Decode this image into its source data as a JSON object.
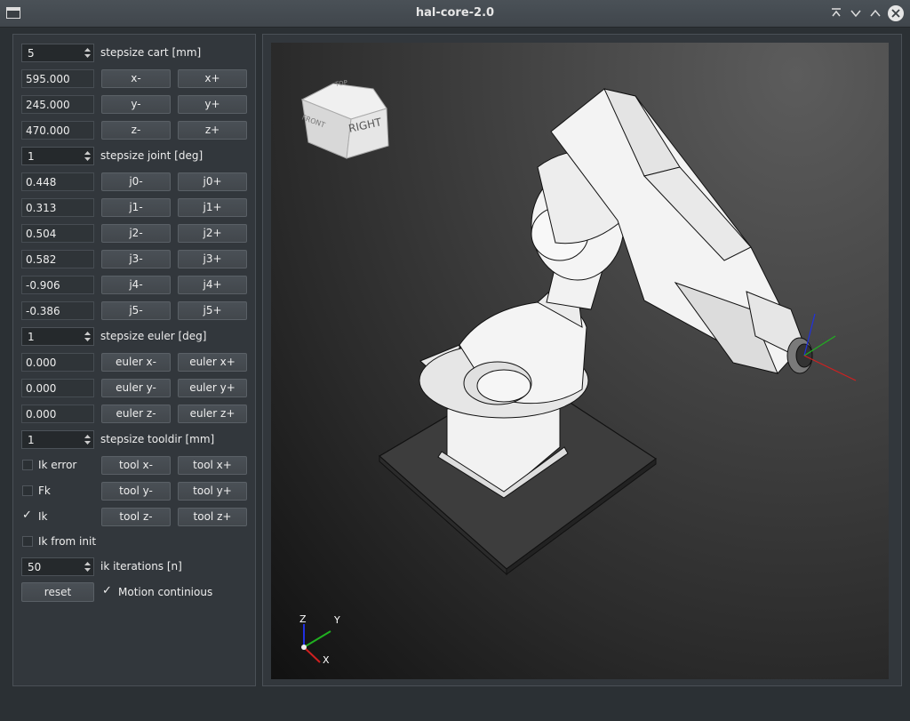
{
  "window": {
    "title": "hal-core-2.0"
  },
  "cart": {
    "stepsize": "5",
    "stepsize_label": "stepsize cart [mm]",
    "rows": [
      {
        "value": "595.000",
        "minus": "x-",
        "plus": "x+"
      },
      {
        "value": "245.000",
        "minus": "y-",
        "plus": "y+"
      },
      {
        "value": "470.000",
        "minus": "z-",
        "plus": "z+"
      }
    ]
  },
  "joint": {
    "stepsize": "1",
    "stepsize_label": "stepsize joint [deg]",
    "rows": [
      {
        "value": "0.448",
        "minus": "j0-",
        "plus": "j0+"
      },
      {
        "value": "0.313",
        "minus": "j1-",
        "plus": "j1+"
      },
      {
        "value": "0.504",
        "minus": "j2-",
        "plus": "j2+"
      },
      {
        "value": "0.582",
        "minus": "j3-",
        "plus": "j3+"
      },
      {
        "value": "-0.906",
        "minus": "j4-",
        "plus": "j4+"
      },
      {
        "value": "-0.386",
        "minus": "j5-",
        "plus": "j5+"
      }
    ]
  },
  "euler": {
    "stepsize": "1",
    "stepsize_label": "stepsize euler [deg]",
    "rows": [
      {
        "value": "0.000",
        "minus": "euler x-",
        "plus": "euler x+"
      },
      {
        "value": "0.000",
        "minus": "euler y-",
        "plus": "euler y+"
      },
      {
        "value": "0.000",
        "minus": "euler z-",
        "plus": "euler z+"
      }
    ]
  },
  "tool": {
    "stepsize": "1",
    "stepsize_label": "stepsize tooldir [mm]",
    "rows": [
      {
        "check_label": "Ik error",
        "checked": false,
        "minus": "tool x-",
        "plus": "tool x+"
      },
      {
        "check_label": "Fk",
        "checked": false,
        "minus": "tool y-",
        "plus": "tool y+"
      },
      {
        "check_label": "Ik",
        "checked": true,
        "minus": "tool z-",
        "plus": "tool z+"
      }
    ]
  },
  "ik_from_init": {
    "label": "Ik from init",
    "checked": false
  },
  "ik_iterations": {
    "value": "50",
    "label": "ik iterations [n]"
  },
  "reset_label": "reset",
  "motion": {
    "label": "Motion continious",
    "checked": true
  },
  "viewcube": {
    "front": "RIGHT",
    "left": "FRONT",
    "top": "TOP"
  },
  "triad": {
    "z": "Z",
    "y": "Y",
    "x": "X"
  },
  "colors": {
    "x_axis": "#d02020",
    "y_axis": "#20b020",
    "z_axis": "#2030e0",
    "accent": "#3c8fd0"
  }
}
